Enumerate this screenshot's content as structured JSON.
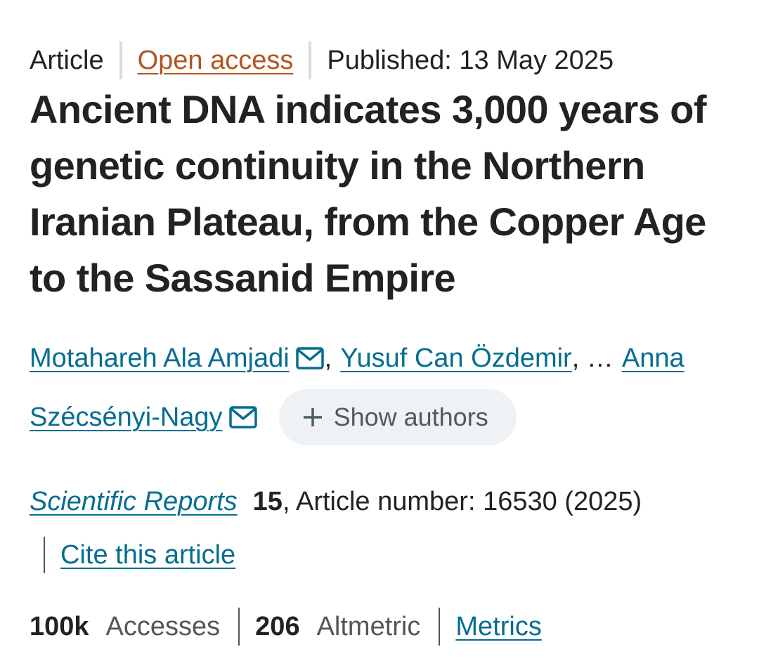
{
  "header": {
    "article_type": "Article",
    "access": "Open access",
    "published": "Published: 13 May 2025"
  },
  "title": "Ancient DNA indicates 3,000 years of genetic continuity in the Northern Iranian Plateau, from the Copper Age to the Sassanid Empire",
  "authors": {
    "first": "Motahareh Ala Amjadi",
    "second": "Yusuf Can Özdemir",
    "comma": ",",
    "ellipsis": ", …",
    "last_part1": "Anna",
    "last_part2": "Szécsényi-Nagy",
    "show_authors_label": "Show authors"
  },
  "journal": {
    "name": "Scientific Reports",
    "volume": "15",
    "article_info": ", Article number: 16530 (2025)",
    "cite_label": "Cite this article"
  },
  "metrics": {
    "accesses_value": "100k",
    "accesses_label": "Accesses",
    "altmetric_value": "206",
    "altmetric_label": "Altmetric",
    "metrics_link": "Metrics"
  },
  "colors": {
    "link": "#046d91",
    "open_access": "#b3541e",
    "text": "#222222",
    "pill_bg": "#eef2f5"
  },
  "icons": [
    "mail-icon",
    "plus-icon"
  ]
}
